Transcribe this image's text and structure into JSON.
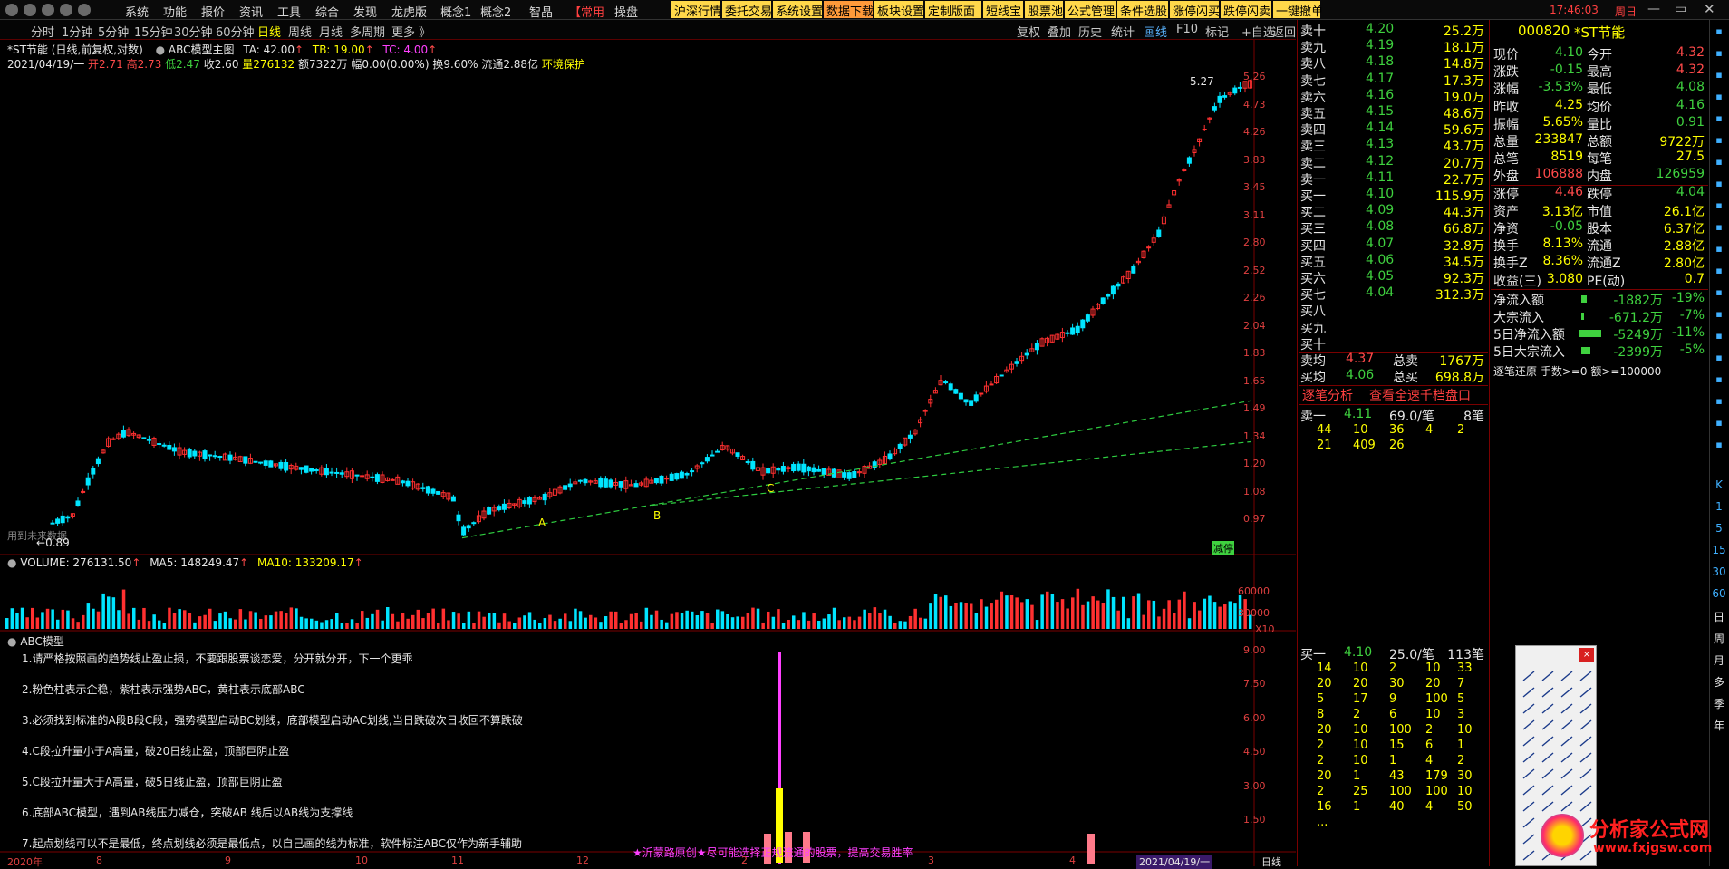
{
  "menu": {
    "items": [
      "系统",
      "功能",
      "报价",
      "资讯",
      "工具",
      "综合",
      "发现",
      "龙虎版",
      "概念1",
      "概念2",
      "智晶",
      "【常用",
      "操盘"
    ],
    "tools": [
      "沪深行情",
      "委托交易",
      "系统设置",
      "数据下载",
      "板块设置",
      "定制版面",
      "短线宝",
      "股票池",
      "公式管理",
      "条件选股",
      "涨停闪买",
      "跌停闪卖",
      "一键撤单"
    ],
    "clock": "17:46:03",
    "weekday": "周日"
  },
  "periods": [
    "分时",
    "1分钟",
    "5分钟",
    "15分钟",
    "30分钟",
    "60分钟",
    "日线",
    "周线",
    "月线",
    "多周期",
    "更多 》"
  ],
  "active_period": "日线",
  "right_tabs": [
    "复权",
    "叠加",
    "历史",
    "统计",
    "画线",
    "F10",
    "标记",
    "+自选",
    "返回"
  ],
  "chart_header": {
    "line1_title": "*ST节能 (日线,前复权,对数)",
    "indicator_name": "ABC模型主图",
    "ta": "TA: 42.00",
    "tb": "TB: 19.00",
    "tc": "TC: 4.00",
    "date": "2021/04/19/一",
    "open": "开2.71",
    "high": "高2.73",
    "low": "低2.47",
    "close": "收2.60",
    "volume": "量276132",
    "amount": "额7322万",
    "change": "幅0.00(0.00%)",
    "turnover": "换9.60%",
    "float": "流通2.88亿",
    "env": "环境保护"
  },
  "price_axis": [
    "5.26",
    "4.73",
    "4.26",
    "3.83",
    "3.45",
    "3.11",
    "2.80",
    "2.52",
    "2.26",
    "2.04",
    "1.83",
    "1.65",
    "1.49",
    "1.34",
    "1.20",
    "1.08",
    "0.97"
  ],
  "price_annotations": {
    "peak": "5.27",
    "low": "0.89",
    "reduce": "减停",
    "future": "用到未来数据",
    "a": "A",
    "b": "B",
    "c": "C"
  },
  "volume_header": {
    "label": "VOLUME: 276131.50",
    "ma5": "MA5: 148249.47",
    "ma10": "MA10: 133209.17"
  },
  "volume_axis": [
    "60000",
    "30000",
    "X10"
  ],
  "abc_panel": {
    "title": "ABC模型",
    "notes": [
      "1.请严格按照画的趋势线止盈止损，不要跟股票谈恋爱，分开就分开，下一个更乖",
      "2.粉色柱表示企稳，紫柱表示强势ABC，黄柱表示底部ABC",
      "3.必须找到标准的A段B段C段，强势模型启动BC划线，底部模型启动AC划线,当日跌破次日收回不算跌破",
      "4.C段拉升量小于A高量，破20日线止盈，顶部巨阴止盈",
      "5.C段拉升量大于A高量，破5日线止盈，顶部巨阴止盈",
      "6.底部ABC模型，遇到AB线压力减仓，突破AB 线后以AB线为支撑线",
      "7.起点划线可以不是最低，终点划线必须是最低点，以自己画的线为标准，软件标注ABC仅作为新手辅助"
    ],
    "footer": "★沂蒙路原创★尽可能选择正规流通的股票，提高交易胜率",
    "axis": [
      "9.00",
      "7.50",
      "6.00",
      "4.50",
      "3.00",
      "1.50"
    ]
  },
  "time_axis": {
    "labels": [
      "2020年",
      "8",
      "9",
      "10",
      "11",
      "12",
      "2",
      "3",
      "4"
    ],
    "current": "2021/04/19/一",
    "mode": "日线"
  },
  "orderbook": {
    "sells": [
      {
        "label": "卖十",
        "price": "4.20",
        "vol": "25.2万"
      },
      {
        "label": "卖九",
        "price": "4.19",
        "vol": "18.1万"
      },
      {
        "label": "卖八",
        "price": "4.18",
        "vol": "14.8万"
      },
      {
        "label": "卖七",
        "price": "4.17",
        "vol": "17.3万"
      },
      {
        "label": "卖六",
        "price": "4.16",
        "vol": "19.0万"
      },
      {
        "label": "卖五",
        "price": "4.15",
        "vol": "48.6万"
      },
      {
        "label": "卖四",
        "price": "4.14",
        "vol": "59.6万"
      },
      {
        "label": "卖三",
        "price": "4.13",
        "vol": "43.7万"
      },
      {
        "label": "卖二",
        "price": "4.12",
        "vol": "20.7万"
      },
      {
        "label": "卖一",
        "price": "4.11",
        "vol": "22.7万"
      }
    ],
    "buys": [
      {
        "label": "买一",
        "price": "4.10",
        "vol": "115.9万"
      },
      {
        "label": "买二",
        "price": "4.09",
        "vol": "44.3万"
      },
      {
        "label": "买三",
        "price": "4.08",
        "vol": "66.8万"
      },
      {
        "label": "买四",
        "price": "4.07",
        "vol": "32.8万"
      },
      {
        "label": "买五",
        "price": "4.06",
        "vol": "34.5万"
      },
      {
        "label": "买六",
        "price": "4.05",
        "vol": "92.3万"
      },
      {
        "label": "买七",
        "price": "4.04",
        "vol": "312.3万"
      },
      {
        "label": "买八",
        "price": "",
        "vol": ""
      },
      {
        "label": "买九",
        "price": "",
        "vol": ""
      },
      {
        "label": "买十",
        "price": "",
        "vol": ""
      }
    ],
    "sell_avg": {
      "label": "卖均",
      "price": "4.37",
      "total_label": "总卖",
      "total": "1767万"
    },
    "buy_avg": {
      "label": "买均",
      "price": "4.06",
      "total_label": "总买",
      "total": "698.8万"
    },
    "links": [
      "逐笔分析",
      "查看全速千档盘口"
    ],
    "queue1": {
      "label": "卖一",
      "price": "4.11",
      "vol": "69.0/笔",
      "count": "8笔",
      "rows": [
        [
          "44",
          "10",
          "36",
          "4",
          "2"
        ],
        [
          "21",
          "409",
          "26",
          "",
          ""
        ]
      ]
    },
    "queue2": {
      "label": "买一",
      "price": "4.10",
      "vol": "25.0/笔",
      "count": "113笔",
      "rows": [
        [
          "14",
          "10",
          "2",
          "10",
          "33"
        ],
        [
          "20",
          "20",
          "30",
          "20",
          "7"
        ],
        [
          "5",
          "17",
          "9",
          "100",
          "5"
        ],
        [
          "8",
          "2",
          "6",
          "10",
          "3"
        ],
        [
          "20",
          "10",
          "100",
          "2",
          "10"
        ],
        [
          "2",
          "10",
          "15",
          "6",
          "1"
        ],
        [
          "2",
          "10",
          "1",
          "4",
          "2"
        ],
        [
          "20",
          "1",
          "43",
          "179",
          "30"
        ],
        [
          "2",
          "25",
          "100",
          "100",
          "10"
        ],
        [
          "16",
          "1",
          "40",
          "4",
          "50"
        ],
        [
          "...",
          "",
          "",
          "",
          ""
        ]
      ]
    }
  },
  "quote": {
    "code": "000820",
    "name": "*ST节能",
    "rows": [
      {
        "l1": "现价",
        "v1": "4.10",
        "l2": "今开",
        "v2": "4.32"
      },
      {
        "l1": "涨跌",
        "v1": "-0.15",
        "l2": "最高",
        "v2": "4.32"
      },
      {
        "l1": "涨幅",
        "v1": "-3.53%",
        "l2": "最低",
        "v2": "4.08"
      },
      {
        "l1": "昨收",
        "v1": "4.25",
        "l2": "均价",
        "v2": "4.16"
      },
      {
        "l1": "振幅",
        "v1": "5.65%",
        "l2": "量比",
        "v2": "0.91"
      },
      {
        "l1": "总量",
        "v1": "233847",
        "l2": "总额",
        "v2": "9722万"
      },
      {
        "l1": "总笔",
        "v1": "8519",
        "l2": "每笔",
        "v2": "27.5"
      },
      {
        "l1": "外盘",
        "v1": "106888",
        "l2": "内盘",
        "v2": "126959"
      },
      {
        "l1": "涨停",
        "v1": "4.46",
        "l2": "跌停",
        "v2": "4.04"
      },
      {
        "l1": "资产",
        "v1": "3.13亿",
        "l2": "市值",
        "v2": "26.1亿"
      },
      {
        "l1": "净资",
        "v1": "-0.05",
        "l2": "股本",
        "v2": "6.37亿"
      },
      {
        "l1": "换手",
        "v1": "8.13%",
        "l2": "流通",
        "v2": "2.88亿"
      },
      {
        "l1": "换手Z",
        "v1": "8.36%",
        "l2": "流通Z",
        "v2": "2.80亿"
      },
      {
        "l1": "收益(三)",
        "v1": "3.080",
        "l2": "PE(动)",
        "v2": "0.7"
      }
    ],
    "flows": [
      {
        "label": "净流入额",
        "value": "-1882万",
        "pct": "-19%"
      },
      {
        "label": "大宗流入",
        "value": "-671.2万",
        "pct": "-7%"
      },
      {
        "label": "5日净流入额",
        "value": "-5249万",
        "pct": "-11%"
      },
      {
        "label": "5日大宗流入",
        "value": "-2399万",
        "pct": "-5%"
      }
    ],
    "filter": "逐笔还原 手数>=0 额>=100000"
  },
  "side_icons": [
    "K",
    "1",
    "5",
    "15",
    "30",
    "60",
    "日",
    "周",
    "月",
    "多",
    "季",
    "年"
  ],
  "watermark": {
    "name": "分析家公式网",
    "url": "www.fxjgsw.com"
  }
}
